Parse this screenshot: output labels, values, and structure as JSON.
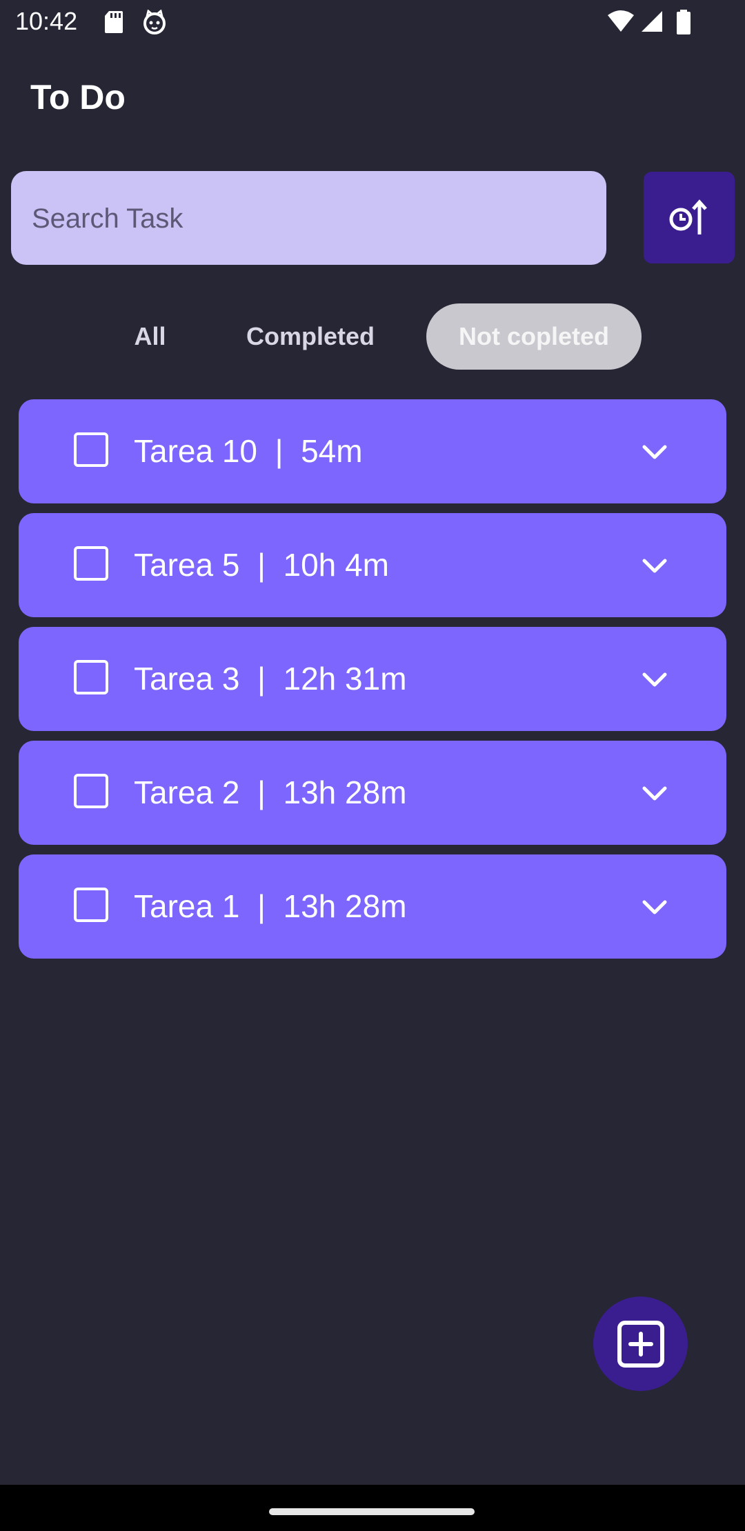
{
  "status_bar": {
    "time": "10:42"
  },
  "app": {
    "title": "To Do"
  },
  "search": {
    "placeholder": "Search Task",
    "value": ""
  },
  "sort_button": {
    "icon": "clock-sort-up-icon"
  },
  "filters": {
    "all": "All",
    "completed": "Completed",
    "not_completed": "Not copleted",
    "selected": "not_completed"
  },
  "tasks": [
    {
      "label": "Tarea 10  |  54m",
      "checked": false
    },
    {
      "label": "Tarea 5  |  10h 4m",
      "checked": false
    },
    {
      "label": "Tarea 3  |  12h 31m",
      "checked": false
    },
    {
      "label": "Tarea 2  |  13h 28m",
      "checked": false
    },
    {
      "label": "Tarea 1  |  13h 28m",
      "checked": false
    }
  ],
  "fab": {
    "icon": "add-box-icon"
  },
  "colors": {
    "background": "#272635",
    "search_bg": "#CBC2F6",
    "card": "#7C66FD",
    "accent_dark": "#3A1E8F",
    "selected_tab": "#C9C8CF"
  }
}
